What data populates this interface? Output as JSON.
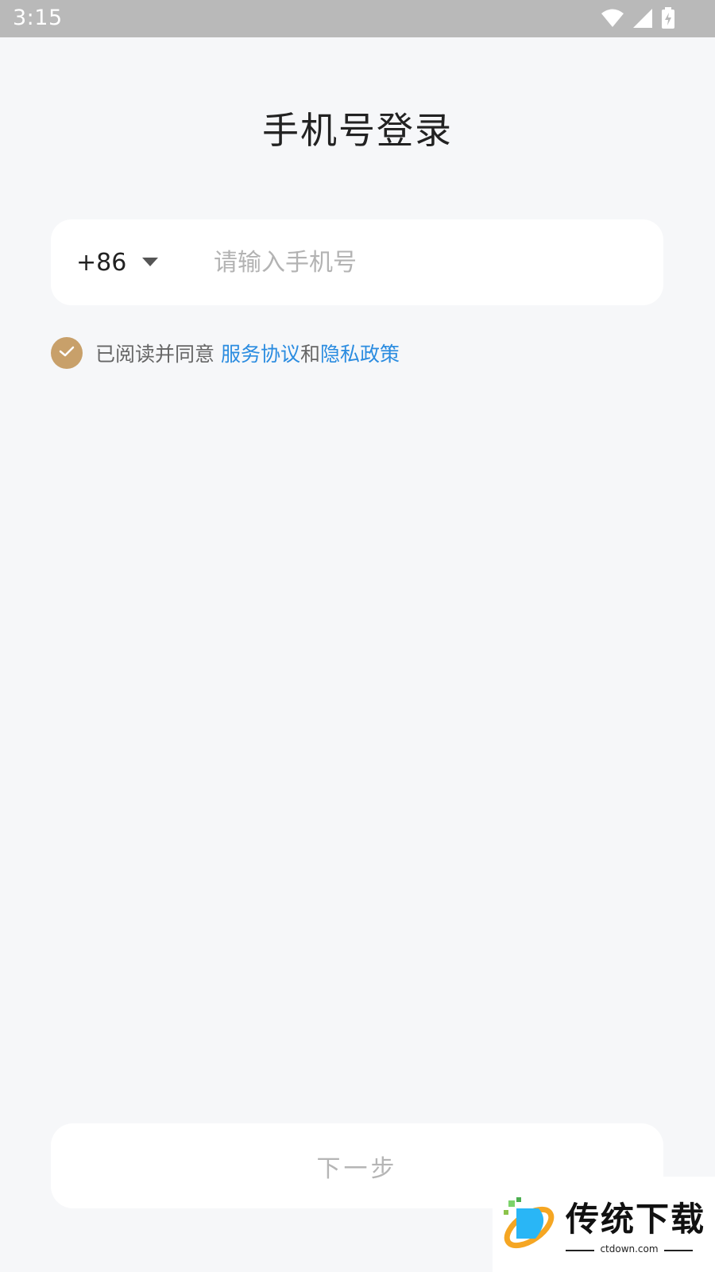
{
  "status_bar": {
    "time": "3:15",
    "icons": [
      "wifi-icon",
      "signal-icon",
      "battery-charging-icon"
    ]
  },
  "page": {
    "title": "手机号登录"
  },
  "phone_form": {
    "country_code": "+86",
    "phone_placeholder": "请输入手机号",
    "phone_value": ""
  },
  "agreement": {
    "checked": true,
    "prefix": "已阅读并同意",
    "terms_link": "服务协议",
    "joiner": "和",
    "privacy_link": "隐私政策"
  },
  "actions": {
    "next_label": "下一步"
  },
  "watermark": {
    "title": "传统下载",
    "subtitle": "ctdown.com"
  },
  "colors": {
    "background": "#f6f7f9",
    "status_bar": "#b9b9b9",
    "accent_check": "#c8a06a",
    "link": "#2b8ce0",
    "disabled_text": "#b5b5b5"
  }
}
